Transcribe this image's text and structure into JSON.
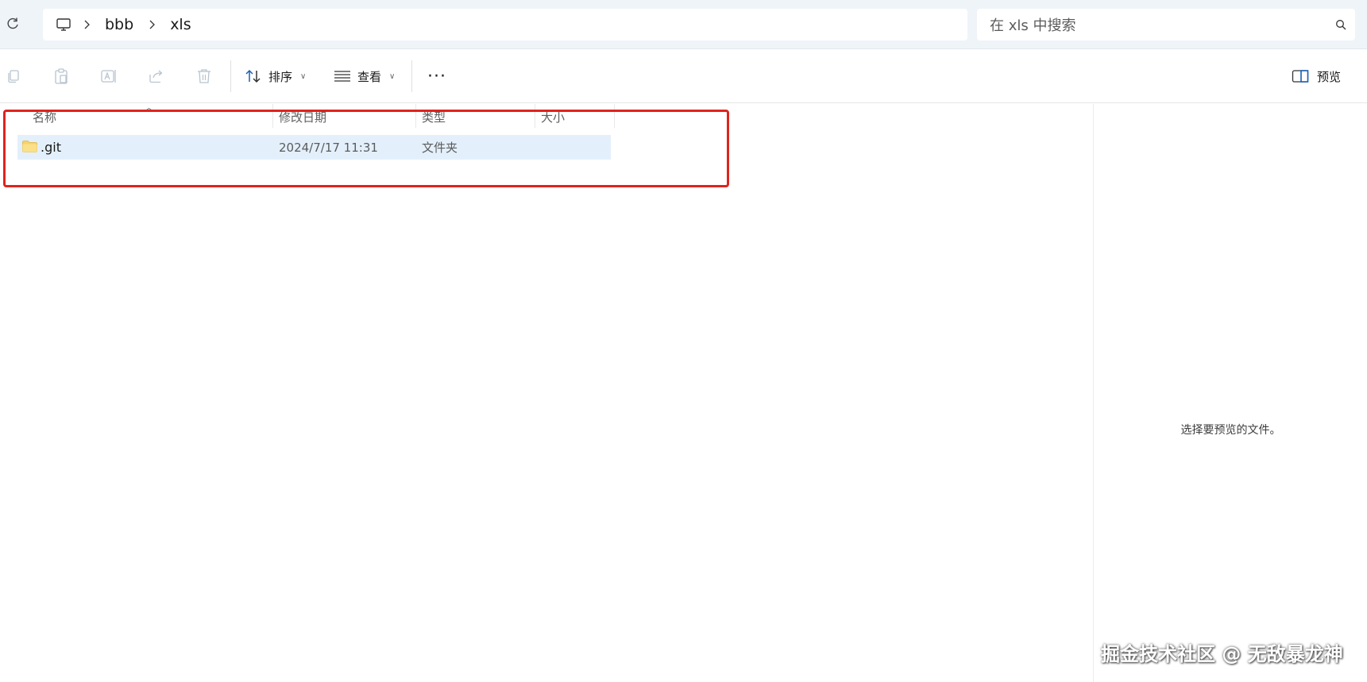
{
  "address_bar": {
    "crumbs": [
      "bbb",
      "xls"
    ],
    "search_placeholder": "在 xls 中搜索"
  },
  "toolbar": {
    "sort_label": "排序",
    "view_label": "查看",
    "more_label": "···",
    "preview_label": "预览"
  },
  "columns": {
    "name": "名称",
    "modified": "修改日期",
    "type": "类型",
    "size": "大小"
  },
  "files": [
    {
      "name": ".git",
      "modified": "2024/7/17 11:31",
      "type": "文件夹",
      "size": ""
    }
  ],
  "preview_pane": {
    "message": "选择要预览的文件。"
  },
  "watermark": "掘金技术社区 @ 无敌暴龙神",
  "colors": {
    "highlight": "#e0231d",
    "selected_row": "#e3f0fc",
    "address_bg": "#eff4f9"
  }
}
